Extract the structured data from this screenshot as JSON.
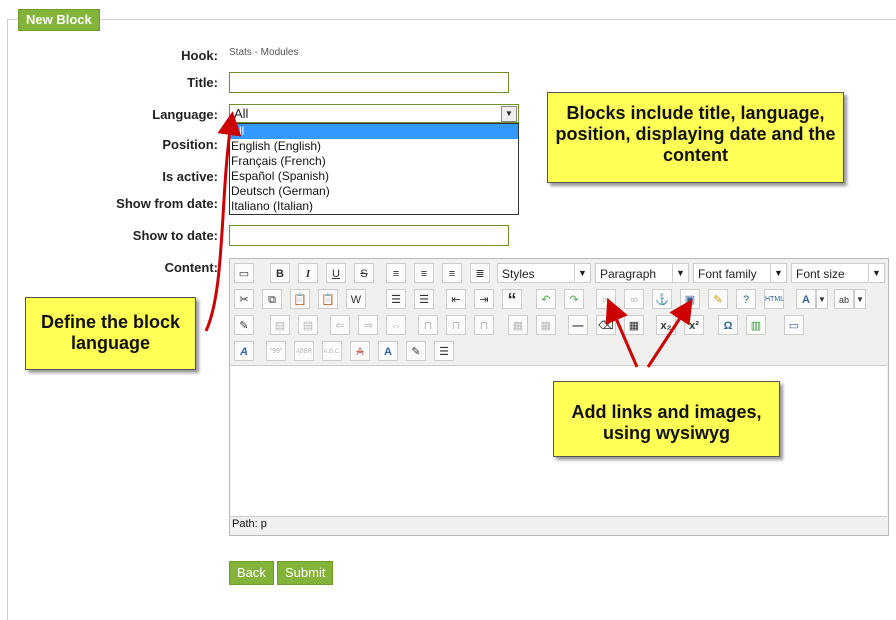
{
  "legend": "New Block",
  "labels": {
    "hook": "Hook:",
    "title": "Title:",
    "language": "Language:",
    "position": "Position:",
    "is_active": "Is active:",
    "show_from": "Show from date:",
    "show_to": "Show to date:",
    "content": "Content:"
  },
  "hook_value": "Stats - Modules",
  "language_select": {
    "selected": "All",
    "options": [
      "All",
      "English (English)",
      "Français (French)",
      "Español (Spanish)",
      "Deutsch (German)",
      "Italiano (Italian)"
    ]
  },
  "editor": {
    "styles": "Styles",
    "format": "Paragraph",
    "font_family": "Font family",
    "font_size": "Font size",
    "path": "Path: p"
  },
  "buttons": {
    "back": "Back",
    "submit": "Submit"
  },
  "callouts": {
    "blocks": "Blocks include title, language, position, displaying date and the content",
    "language": "Define the block language",
    "links": "Add links and images, using wysiwyg"
  },
  "colors": {
    "green": "#84b33a",
    "callout": "#ffff55",
    "arrow": "#cc0000"
  }
}
